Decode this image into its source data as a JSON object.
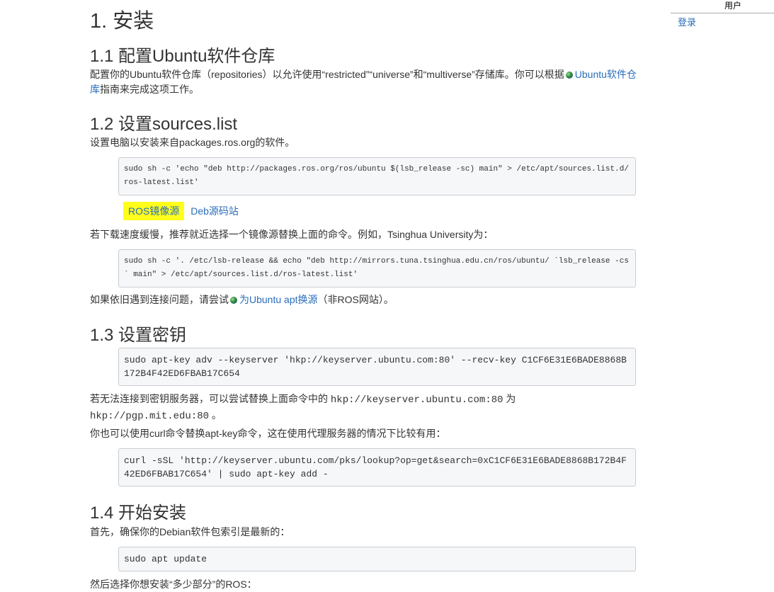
{
  "sidebar": {
    "header": "用户",
    "login": "登录"
  },
  "s1": {
    "title": "1. 安装"
  },
  "s11": {
    "title": "1.1 配置Ubuntu软件仓库",
    "text_a": "配置你的Ubuntu软件仓库（repositories）以允许使用“restricted”“universe”和“multiverse”存储库。你可以根据",
    "link": "Ubuntu软件仓库",
    "text_b": "指南来完成这项工作。"
  },
  "s12": {
    "title": "1.2 设置sources.list",
    "intro": "设置电脑以安装来自packages.ros.org的软件。",
    "cmd1_line1": "sudo sh -c 'echo \"deb http://packages.ros.org/ros/ubuntu $(lsb_release -sc) main\" > /etc/apt/sources.list.d/",
    "cmd1_line2": "ros-latest.list'",
    "tab_active": "ROS镜像源",
    "tab_other": "Deb源码站",
    "mirror_text": "若下载速度缓慢，推荐就近选择一个镜像源替换上面的命令。例如，Tsinghua University为：",
    "cmd2_line1": "sudo sh -c '. /etc/lsb-release && echo \"deb http://mirrors.tuna.tsinghua.edu.cn/ros/ubuntu/ `lsb_release -cs",
    "cmd2_line2": "` main\" > /etc/apt/sources.list.d/ros-latest.list'",
    "problem_a": "如果依旧遇到连接问题，请尝试",
    "problem_link": "为Ubuntu apt换源",
    "problem_b": "（非ROS网站）。"
  },
  "s13": {
    "title": "1.3 设置密钥",
    "cmd_line1": "sudo apt-key adv --keyserver 'hkp://keyserver.ubuntu.com:80' --recv-key C1CF6E31E6BADE8868B",
    "cmd_line2": "172B4F42ED6FBAB17C654",
    "alt_a": "若无法连接到密钥服务器，可以尝试替换上面命令中的 ",
    "alt_code1": "hkp://keyserver.ubuntu.com:80",
    "alt_b": " 为",
    "alt_code2": "hkp://pgp.mit.edu:80",
    "alt_c": " 。",
    "curl_text": "你也可以使用curl命令替换apt-key命令，这在使用代理服务器的情况下比较有用：",
    "curl_line1": "curl -sSL 'http://keyserver.ubuntu.com/pks/lookup?op=get&search=0xC1CF6E31E6BADE8868B172B4F",
    "curl_line2": "42ED6FBAB17C654' | sudo apt-key add -"
  },
  "s14": {
    "title": "1.4 开始安装",
    "intro": "首先，确保你的Debian软件包索引是最新的：",
    "cmd": "sudo apt update",
    "next": "然后选择你想安装“多少部分”的ROS："
  },
  "colors": {
    "link": "#2a6ebb",
    "highlight": "#ffff1a",
    "code_bg": "#f6f7f9",
    "code_border": "#c9ccd1"
  },
  "icons": {
    "external_link": "globe-icon"
  }
}
